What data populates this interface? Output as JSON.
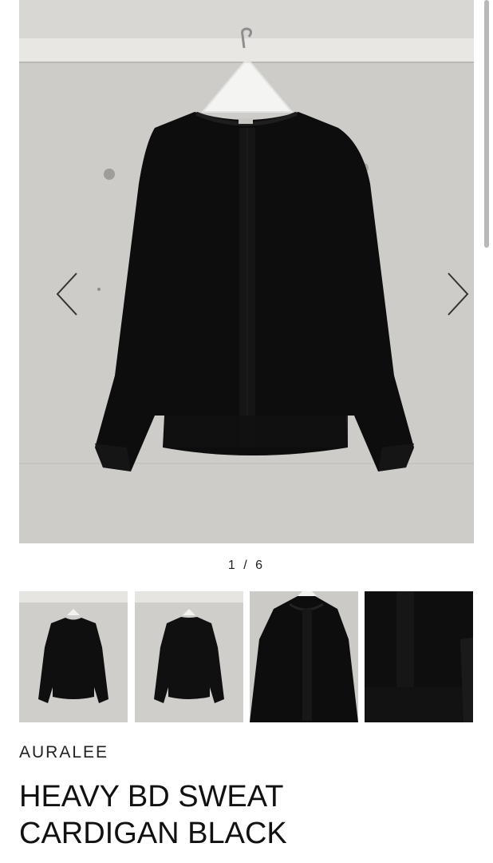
{
  "product": {
    "brand": "AURALEE",
    "title_line1": "HEAVY BD SWEAT",
    "title_line2": "CARDIGAN BLACK"
  },
  "gallery": {
    "counter": "1 / 6",
    "current": 1,
    "total": 6,
    "thumbnails": [
      {
        "name": "front"
      },
      {
        "name": "back"
      },
      {
        "name": "front-closeup"
      },
      {
        "name": "placket-closeup"
      }
    ]
  },
  "icons": {
    "prev": "chevron-left-icon",
    "next": "chevron-right-icon"
  },
  "colors": {
    "garment": "#0d0d0d",
    "wall": "#cfceca",
    "text": "#111111"
  }
}
